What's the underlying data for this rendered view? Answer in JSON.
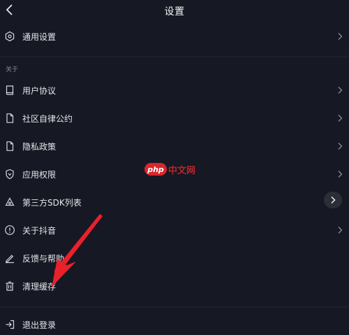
{
  "header": {
    "title": "设置"
  },
  "general": {
    "label": "通用设置"
  },
  "section_about": {
    "label": "关于"
  },
  "items": [
    {
      "label": "用户协议"
    },
    {
      "label": "社区自律公约"
    },
    {
      "label": "隐私政策"
    },
    {
      "label": "应用权限"
    },
    {
      "label": "第三方SDK列表"
    },
    {
      "label": "关于抖音"
    },
    {
      "label": "反馈与帮助"
    },
    {
      "label": "清理缓存"
    }
  ],
  "logout": {
    "label": "退出登录"
  },
  "watermark": {
    "logo_text": "php",
    "text": "中文网"
  },
  "colors": {
    "background": "#161823",
    "arrow": "#e8212b",
    "watermark": "#d9262c"
  }
}
